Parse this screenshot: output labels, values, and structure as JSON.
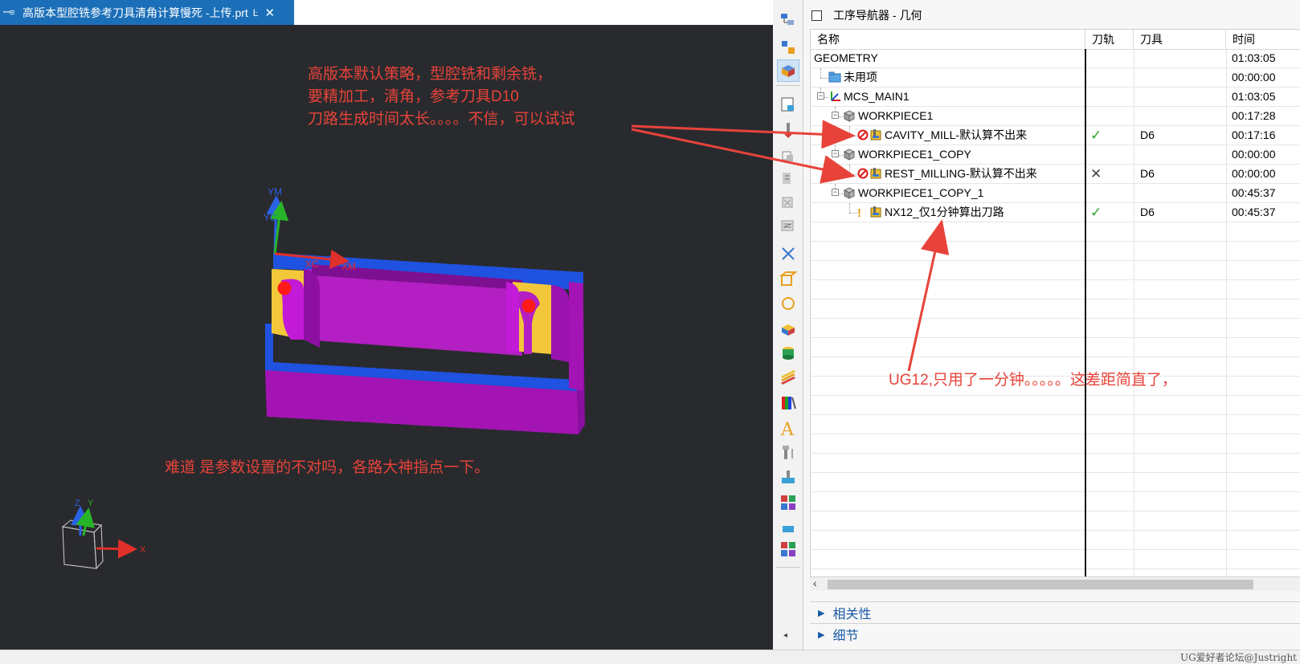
{
  "tab": {
    "title": "高版本型腔铣参考刀具清角计算慢死 -上传.prt",
    "icon": "part-file-icon",
    "pin_glyph": "Ŀ",
    "close_glyph": "✕"
  },
  "viewport": {
    "annotations": {
      "top_note": "高版本默认策略，型腔铣和剩余铣，\n要精加工，清角，参考刀具D10\n刀路生成时间太长。。。。不信，可以试试",
      "bottom_note": "难道 是参数设置的不对吗，各路大神指点一下。",
      "right_note": "UG12,只用了一分钟。。。。。这差距简直了，"
    },
    "axis_labels": {
      "ym": "YM",
      "yc": "YC",
      "xc": "XC",
      "xm": "XM",
      "triad_z": "Z",
      "triad_y": "Y",
      "triad_x": "X"
    }
  },
  "navigator": {
    "title": "工序导航器 - 几何",
    "columns": {
      "name": "名称",
      "path": "刀轨",
      "tool": "刀具",
      "time": "时间"
    },
    "rows": [
      {
        "name": "GEOMETRY",
        "indent": 0,
        "expander": "",
        "icon": "",
        "status": "",
        "path": "",
        "tool": "",
        "time": "01:03:05"
      },
      {
        "name": "未用项",
        "indent": 1,
        "expander": "",
        "icon": "folder-icon",
        "status": "",
        "path": "",
        "tool": "",
        "time": "00:00:00"
      },
      {
        "name": "MCS_MAIN1",
        "indent": 1,
        "expander": "−",
        "icon": "mcs-icon",
        "status": "",
        "path": "",
        "tool": "",
        "time": "01:03:05"
      },
      {
        "name": "WORKPIECE1",
        "indent": 2,
        "expander": "−",
        "icon": "workpiece-icon",
        "status": "",
        "path": "",
        "tool": "",
        "time": "00:17:28"
      },
      {
        "name": "CAVITY_MILL-默认算不出来",
        "indent": 3,
        "expander": "",
        "icon": "operation-icon",
        "status": "prohibited",
        "path": "✓",
        "tool": "D6",
        "time": "00:17:16"
      },
      {
        "name": "WORKPIECE1_COPY",
        "indent": 2,
        "expander": "−",
        "icon": "workpiece-icon",
        "status": "",
        "path": "",
        "tool": "",
        "time": "00:00:00"
      },
      {
        "name": "REST_MILLING-默认算不出来",
        "indent": 3,
        "expander": "",
        "icon": "operation-icon",
        "status": "prohibited",
        "path": "✕",
        "tool": "D6",
        "time": "00:00:00"
      },
      {
        "name": "WORKPIECE1_COPY_1",
        "indent": 2,
        "expander": "−",
        "icon": "workpiece-icon",
        "status": "",
        "path": "",
        "tool": "",
        "time": "00:45:37"
      },
      {
        "name": "NX12_仅1分钟算出刀路",
        "indent": 3,
        "expander": "",
        "icon": "operation-icon",
        "status": "warning",
        "path": "✓",
        "tool": "D6",
        "time": "00:45:37"
      }
    ],
    "panels": {
      "dependencies": "相关性",
      "details": "细节"
    }
  },
  "toolbar": {
    "icons": [
      "program-order-view-icon",
      "machine-tool-view-icon",
      "geometry-view-icon",
      "create-program-icon",
      "create-tool-icon",
      "create-geometry-icon",
      "create-method-icon",
      "create-operation-icon",
      "generate-toolpath-icon",
      "delete-toolpath-icon",
      "verify-toolpath-icon",
      "simulate-icon",
      "box-icon",
      "circle-icon",
      "block-icon",
      "cylinder-icon",
      "layers-icon",
      "color-gradient-icon",
      "text-a-icon",
      "tool-holder-icon",
      "brush-icon",
      "color-grid-icon"
    ],
    "scroll_glyph": "◂"
  },
  "statusbar": {
    "watermark": "UG爱好者论坛@Justright"
  },
  "colors": {
    "tab_active": "#1b6fb8",
    "viewport_bg": "#292a2d",
    "annotation": "#e8433a",
    "part_magenta": "#a414b4",
    "part_blue": "#1f52e0",
    "part_yellow": "#f2c83a",
    "check_green": "#2aa52a",
    "link_blue": "#1a5aa6"
  }
}
